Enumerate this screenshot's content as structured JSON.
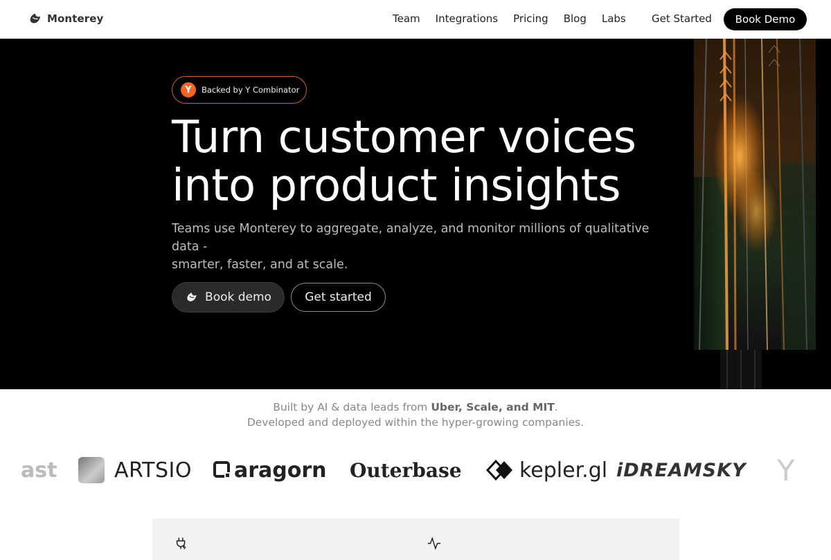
{
  "nav": {
    "brand": "Monterey",
    "links": [
      "Team",
      "Integrations",
      "Pricing",
      "Blog",
      "Labs"
    ],
    "get_started": "Get Started",
    "book_demo": "Book Demo"
  },
  "hero": {
    "badge_icon": "Y",
    "badge_text": "Backed by Y Combinator",
    "title_line1": "Turn customer voices",
    "title_line2": "into product insights",
    "subtitle_line1": "Teams use Monterey to aggregate, analyze, and monitor millions of qualitative data -",
    "subtitle_line2": "smarter, faster, and at scale.",
    "btn_demo": "Book demo",
    "btn_start": "Get started"
  },
  "trust": {
    "line1_prefix": "Built by AI & data leads from ",
    "line1_bold": "Uber, Scale, and MIT",
    "line1_suffix": ".",
    "line2": "Developed and deployed within the hyper-growing companies."
  },
  "logos": {
    "faded": "ast",
    "artsio": "ARTSIO",
    "aragorn": "aragorn",
    "outerbase": "Outerbase",
    "kepler": "kepler.gl",
    "dreamsky": "iDREAMSKY",
    "y": "Y"
  },
  "colors": {
    "accent_orange": "#f26522",
    "hero_bg": "#000000",
    "card_bg": "#f2f2f2"
  },
  "icons": {
    "card_left": "plug-icon",
    "card_right": "activity-icon"
  }
}
